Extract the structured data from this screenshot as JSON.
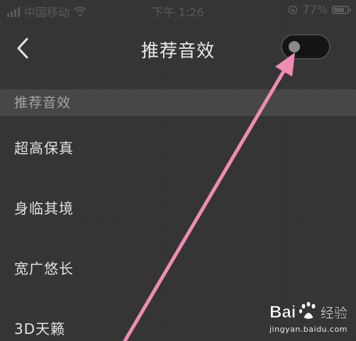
{
  "status_bar": {
    "carrier": "中国移动",
    "time": "下午 1:26",
    "battery": "77%"
  },
  "nav": {
    "title": "推荐音效",
    "toggle_on": false
  },
  "section": {
    "header": "推荐音效"
  },
  "effects": [
    {
      "label": "超高保真"
    },
    {
      "label": "身临其境"
    },
    {
      "label": "宽广悠长"
    },
    {
      "label": "3D天籁"
    }
  ],
  "watermark": {
    "brand": "Bai 经验",
    "url": "jingyan.baidu.com"
  },
  "colors": {
    "background": "#333333",
    "section_header": "#474747",
    "annotation_arrow": "#ee8cb4"
  },
  "icons": {
    "back": "chevron-left-icon",
    "wifi": "wifi-icon",
    "battery": "battery-icon",
    "lock": "rotation-lock-icon"
  }
}
